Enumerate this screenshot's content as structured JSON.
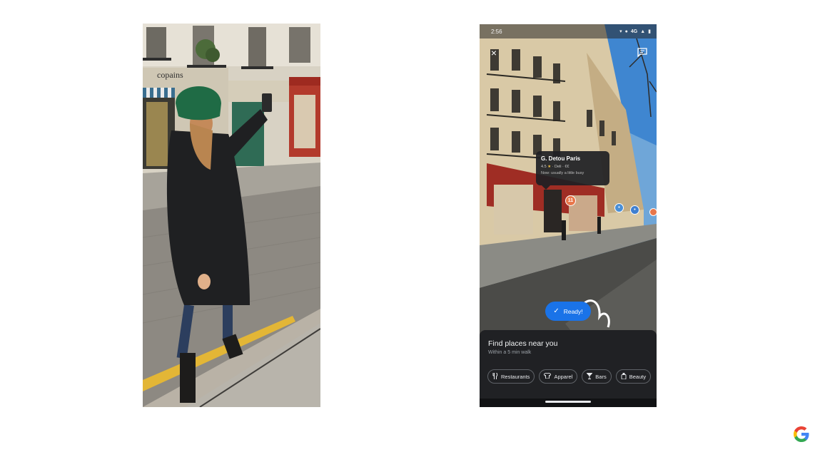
{
  "photo": {
    "shop_sign": "copains"
  },
  "phone": {
    "status_bar": {
      "time": "2:56",
      "network": "4G"
    },
    "close_icon": "×",
    "place_card": {
      "name": "G. Detou Paris",
      "rating": "4.5",
      "star": "★",
      "meta_suffix": "· Deli · €€",
      "busy": "Now: usually a little busy"
    },
    "pins": [
      "11"
    ],
    "ready_chip": {
      "check_icon": "✓",
      "label": "Ready!"
    },
    "bottom_sheet": {
      "title": "Find places near you",
      "subtitle": "Within a 5 min walk",
      "chips": [
        {
          "icon": "fork-knife-icon",
          "glyph": "🍴",
          "label": "Restaurants"
        },
        {
          "icon": "shirt-icon",
          "glyph": "👕",
          "label": "Apparel"
        },
        {
          "icon": "cocktail-icon",
          "glyph": "🍸",
          "label": "Bars"
        },
        {
          "icon": "bottle-icon",
          "glyph": "🧴",
          "label": "Beauty"
        }
      ]
    }
  },
  "colors": {
    "accent_blue": "#1a73e8",
    "sheet_bg": "#202124",
    "pin_orange": "#e8774b",
    "pin_blue": "#4a8fd6"
  }
}
